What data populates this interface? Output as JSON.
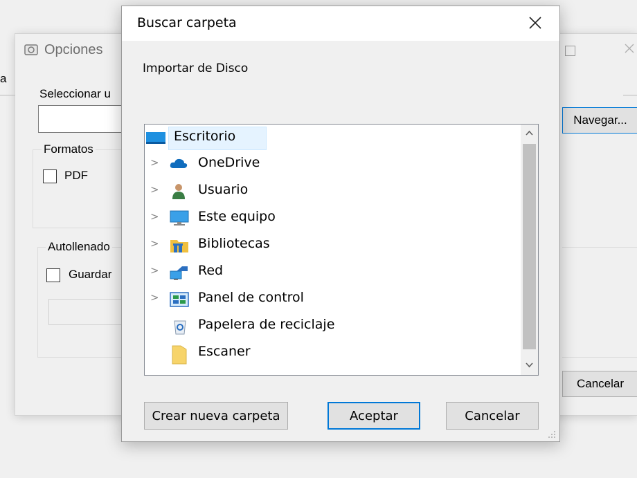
{
  "background_window": {
    "title": "Opciones",
    "left_edge_char": "a",
    "select_label": "Seleccionar u",
    "browse_button": "Navegar...",
    "formats_group": "Formatos",
    "pdf_label": "PDF",
    "autofill_group": "Autollenado",
    "save_label": "Guardar",
    "cancel_button": "Cancelar"
  },
  "dialog": {
    "title": "Buscar carpeta",
    "close_glyph": "×",
    "description": "Importar de Disco",
    "tree": [
      {
        "label": "Escritorio",
        "icon": "desktop-icon",
        "expandable": false,
        "selected": true
      },
      {
        "label": "OneDrive",
        "icon": "cloud-icon",
        "expandable": true,
        "selected": false
      },
      {
        "label": "Usuario",
        "icon": "user-icon",
        "expandable": true,
        "selected": false
      },
      {
        "label": "Este equipo",
        "icon": "computer-icon",
        "expandable": true,
        "selected": false
      },
      {
        "label": "Bibliotecas",
        "icon": "libraries-icon",
        "expandable": true,
        "selected": false
      },
      {
        "label": "Red",
        "icon": "network-icon",
        "expandable": true,
        "selected": false
      },
      {
        "label": "Panel de control",
        "icon": "control-panel-icon",
        "expandable": true,
        "selected": false
      },
      {
        "label": "Papelera de reciclaje",
        "icon": "recycle-bin-icon",
        "expandable": false,
        "selected": false
      },
      {
        "label": "Escaner",
        "icon": "folder-icon",
        "expandable": false,
        "selected": false
      }
    ],
    "chevron_glyph": ">",
    "scroll_up_glyph": "⌃",
    "scroll_down_glyph": "⌄",
    "buttons": {
      "new_folder": "Crear nueva carpeta",
      "ok": "Aceptar",
      "cancel": "Cancelar"
    }
  },
  "colors": {
    "selection": "#e5f3ff",
    "accent": "#0078d7"
  }
}
